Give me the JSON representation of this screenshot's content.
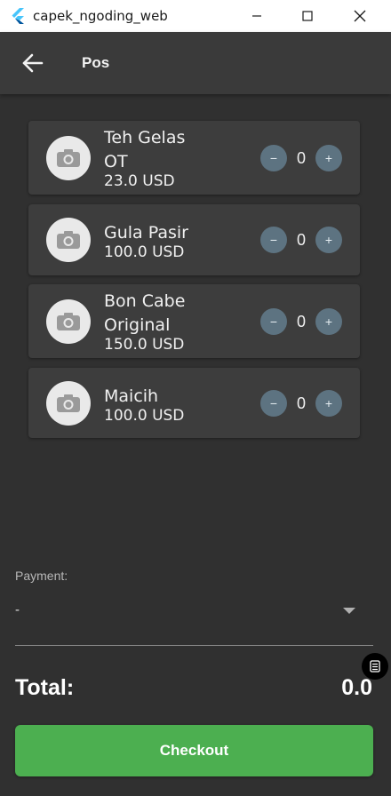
{
  "window": {
    "title": "capek_ngoding_web",
    "accent": "#4caf50"
  },
  "appbar": {
    "title": "Pos"
  },
  "products": [
    {
      "name_line1": "Teh Gelas",
      "name_line2": "OT",
      "price": "23.0 USD",
      "qty": "0",
      "minus": "−",
      "plus": "+"
    },
    {
      "name_line1": "Gula Pasir",
      "price": "100.0 USD",
      "qty": "0",
      "minus": "−",
      "plus": "+"
    },
    {
      "name_line1": "Bon Cabe",
      "name_line2": "Original",
      "price": "150.0 USD",
      "qty": "0",
      "minus": "−",
      "plus": "+"
    },
    {
      "name_line1": "Maicih",
      "price": "100.0 USD",
      "qty": "0",
      "minus": "−",
      "plus": "+"
    }
  ],
  "payment": {
    "label": "Payment:",
    "value": "-"
  },
  "total": {
    "label": "Total:",
    "value": "0.0"
  },
  "checkout": {
    "label": "Checkout"
  }
}
